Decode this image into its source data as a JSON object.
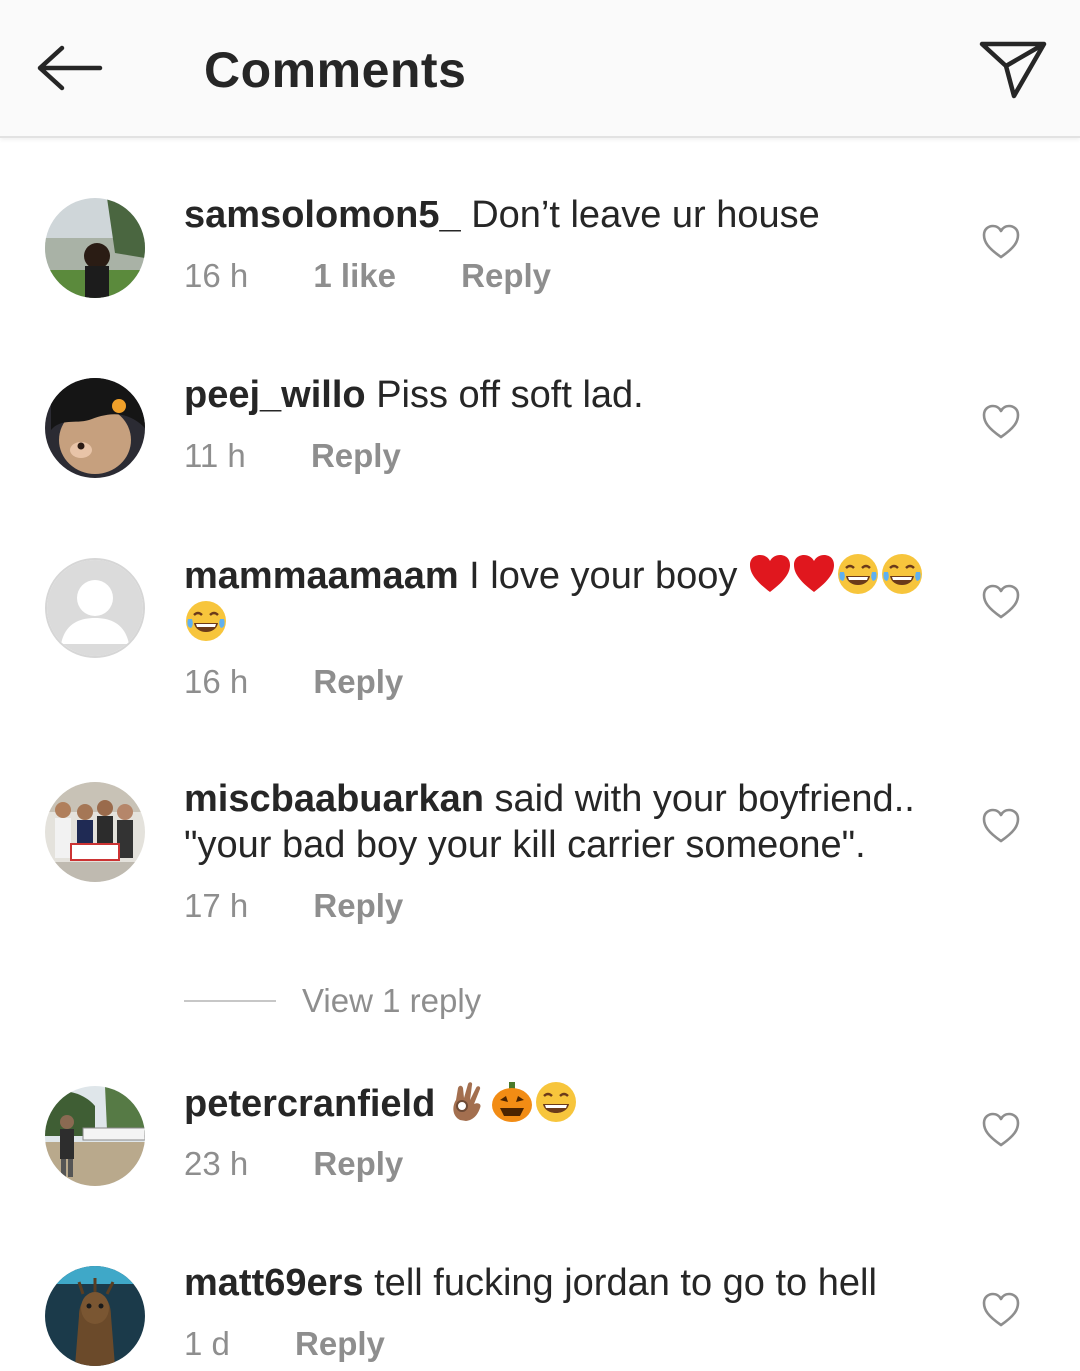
{
  "header": {
    "title": "Comments",
    "back_icon": "arrow-left-icon",
    "send_icon": "paper-plane-icon"
  },
  "colors": {
    "text": "#262626",
    "muted": "#8e8e8e",
    "header_bg": "#fafafa",
    "heart_emoji": "#e0171e",
    "face_emoji": "#f7c53c"
  },
  "comments": [
    {
      "username": "samsolomon5_",
      "text": "Don’t leave ur house",
      "time": "16 h",
      "likes": "1 like",
      "reply": "Reply"
    },
    {
      "username": "peej_willo",
      "text": "Piss off soft lad.",
      "time": "11 h",
      "reply": "Reply"
    },
    {
      "username": "mammaamaam",
      "text": "I love your booy",
      "emojis": [
        "red-heart",
        "red-heart",
        "tears-of-joy",
        "tears-of-joy",
        "tears-of-joy"
      ],
      "time": "16 h",
      "reply": "Reply"
    },
    {
      "username": "miscbaabuarkan",
      "text": "said with your boyfriend.. \"your bad boy your kill carrier someone\".",
      "time": "17 h",
      "reply": "Reply",
      "view_replies": "View 1 reply"
    },
    {
      "username": "petercranfield",
      "text": "",
      "emojis": [
        "ok-hand",
        "jack-o-lantern",
        "grinning-face"
      ],
      "time": "23 h",
      "reply": "Reply"
    },
    {
      "username": "matt69ers",
      "text": "tell fucking jordan to go to hell",
      "time": "1 d",
      "reply": "Reply"
    }
  ]
}
